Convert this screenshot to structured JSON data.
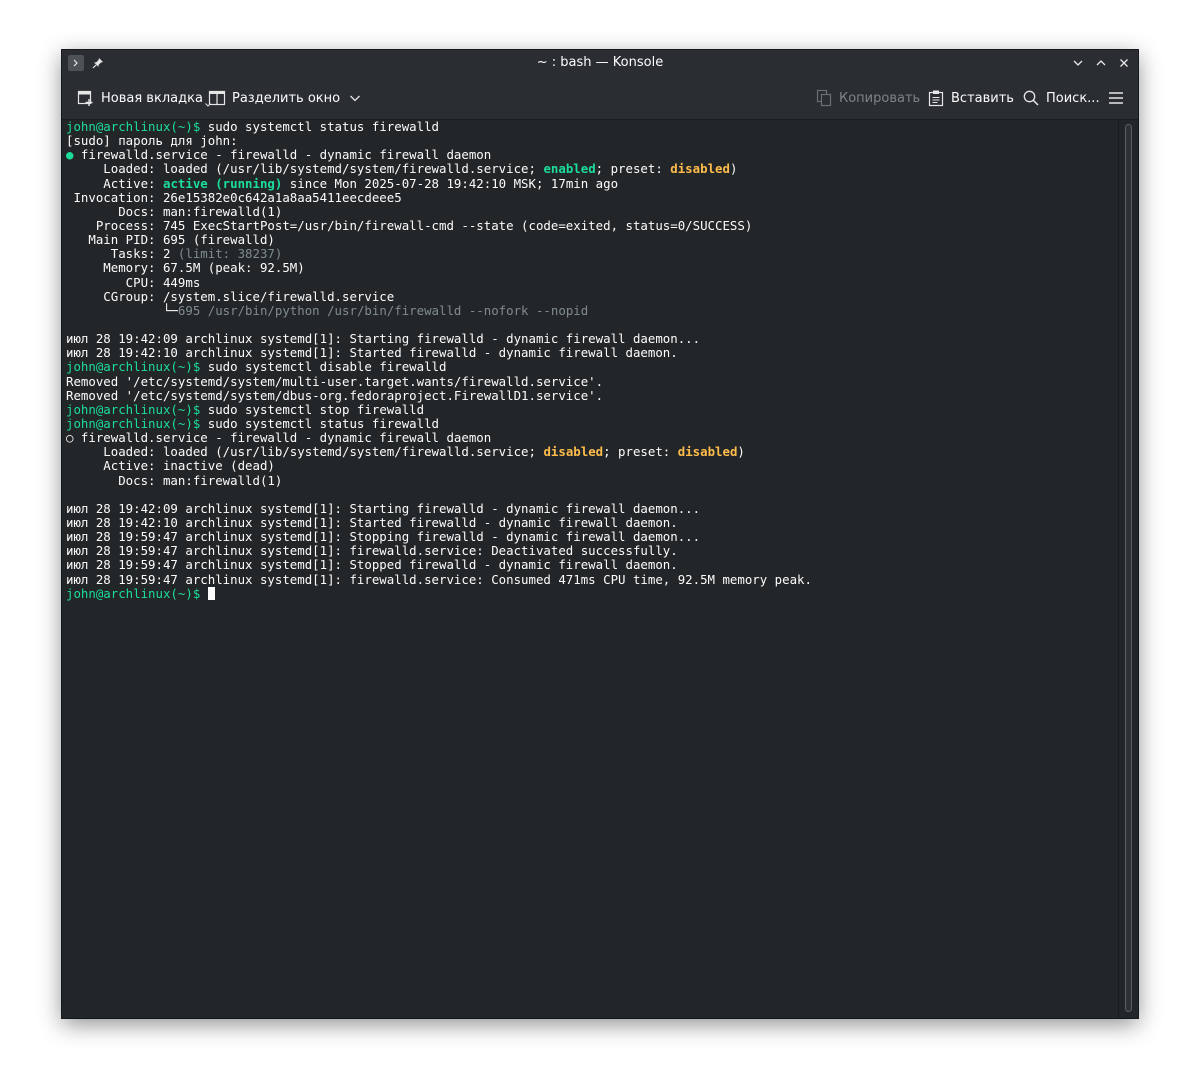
{
  "window": {
    "title": "~ : bash — Konsole"
  },
  "titlebar": {
    "icons": [
      "terminal-app-icon",
      "pin-icon",
      "minimize-icon",
      "maximize-icon",
      "close-icon"
    ]
  },
  "toolbar": {
    "new_tab": "Новая вкладка",
    "split_view": "Разделить окно",
    "copy": "Копировать",
    "paste": "Вставить",
    "find": "Поиск...",
    "icons": [
      "new-tab-icon",
      "split-view-icon",
      "chevron-down-icon",
      "copy-icon",
      "paste-icon",
      "search-icon",
      "hamburger-menu-icon"
    ]
  },
  "colors": {
    "background": "#232629",
    "prompt": "#1cdc9a",
    "enabled_active": "#1cdc9a",
    "disabled": "#fdbc4b",
    "dim": "#7f8c8d",
    "text": "#fcfcfc"
  },
  "terminal": {
    "lines": [
      [
        {
          "t": "john@archlinux(~)$",
          "c": "green"
        },
        {
          "t": " sudo systemctl status firewalld"
        }
      ],
      [
        {
          "t": "[sudo] пароль для john:"
        }
      ],
      [
        {
          "t": "●",
          "c": "green"
        },
        {
          "t": " firewalld.service - firewalld - dynamic firewall daemon"
        }
      ],
      [
        {
          "t": "     Loaded: loaded (/usr/lib/systemd/system/firewalld.service; "
        },
        {
          "t": "enabled",
          "c": "green-b"
        },
        {
          "t": "; preset: "
        },
        {
          "t": "disabled",
          "c": "yellow-b"
        },
        {
          "t": ")"
        }
      ],
      [
        {
          "t": "     Active: "
        },
        {
          "t": "active (running)",
          "c": "green-b"
        },
        {
          "t": " since Mon 2025-07-28 19:42:10 MSK; 17min ago"
        }
      ],
      [
        {
          "t": " Invocation: 26e15382e0c642a1a8aa5411eecdeee5"
        }
      ],
      [
        {
          "t": "       Docs: man:firewalld(1)"
        }
      ],
      [
        {
          "t": "    Process: 745 ExecStartPost=/usr/bin/firewall-cmd --state (code=exited, status=0/SUCCESS)"
        }
      ],
      [
        {
          "t": "   Main PID: 695 (firewalld)"
        }
      ],
      [
        {
          "t": "      Tasks: 2 "
        },
        {
          "t": "(limit: 38237)",
          "c": "gray"
        }
      ],
      [
        {
          "t": "     Memory: 67.5M (peak: 92.5M)"
        }
      ],
      [
        {
          "t": "        CPU: 449ms"
        }
      ],
      [
        {
          "t": "     CGroup: /system.slice/firewalld.service"
        }
      ],
      [
        {
          "t": "             └─",
          "c": "white"
        },
        {
          "t": "695 /usr/bin/python /usr/bin/firewalld --nofork --nopid",
          "c": "gray"
        }
      ],
      [
        {
          "t": ""
        }
      ],
      [
        {
          "t": "июл 28 19:42:09 archlinux systemd[1]: Starting firewalld - dynamic firewall daemon..."
        }
      ],
      [
        {
          "t": "июл 28 19:42:10 archlinux systemd[1]: Started firewalld - dynamic firewall daemon."
        }
      ],
      [
        {
          "t": "john@archlinux(~)$",
          "c": "green"
        },
        {
          "t": " sudo systemctl disable firewalld"
        }
      ],
      [
        {
          "t": "Removed '/etc/systemd/system/multi-user.target.wants/firewalld.service'."
        }
      ],
      [
        {
          "t": "Removed '/etc/systemd/system/dbus-org.fedoraproject.FirewallD1.service'."
        }
      ],
      [
        {
          "t": "john@archlinux(~)$",
          "c": "green"
        },
        {
          "t": " sudo systemctl stop firewalld"
        }
      ],
      [
        {
          "t": "john@archlinux(~)$",
          "c": "green"
        },
        {
          "t": " sudo systemctl status firewalld"
        }
      ],
      [
        {
          "t": "○ firewalld.service - firewalld - dynamic firewall daemon"
        }
      ],
      [
        {
          "t": "     Loaded: loaded (/usr/lib/systemd/system/firewalld.service; "
        },
        {
          "t": "disabled",
          "c": "yellow-b"
        },
        {
          "t": "; preset: "
        },
        {
          "t": "disabled",
          "c": "yellow-b"
        },
        {
          "t": ")"
        }
      ],
      [
        {
          "t": "     Active: inactive (dead)"
        }
      ],
      [
        {
          "t": "       Docs: man:firewalld(1)"
        }
      ],
      [
        {
          "t": ""
        }
      ],
      [
        {
          "t": "июл 28 19:42:09 archlinux systemd[1]: Starting firewalld - dynamic firewall daemon..."
        }
      ],
      [
        {
          "t": "июл 28 19:42:10 archlinux systemd[1]: Started firewalld - dynamic firewall daemon."
        }
      ],
      [
        {
          "t": "июл 28 19:59:47 archlinux systemd[1]: Stopping firewalld - dynamic firewall daemon..."
        }
      ],
      [
        {
          "t": "июл 28 19:59:47 archlinux systemd[1]: firewalld.service: Deactivated successfully."
        }
      ],
      [
        {
          "t": "июл 28 19:59:47 archlinux systemd[1]: Stopped firewalld - dynamic firewall daemon."
        }
      ],
      [
        {
          "t": "июл 28 19:59:47 archlinux systemd[1]: firewalld.service: Consumed 471ms CPU time, 92.5M memory peak."
        }
      ],
      [
        {
          "t": "john@archlinux(~)$",
          "c": "green"
        },
        {
          "t": " "
        },
        {
          "t": "",
          "c": "cursor"
        }
      ]
    ]
  }
}
